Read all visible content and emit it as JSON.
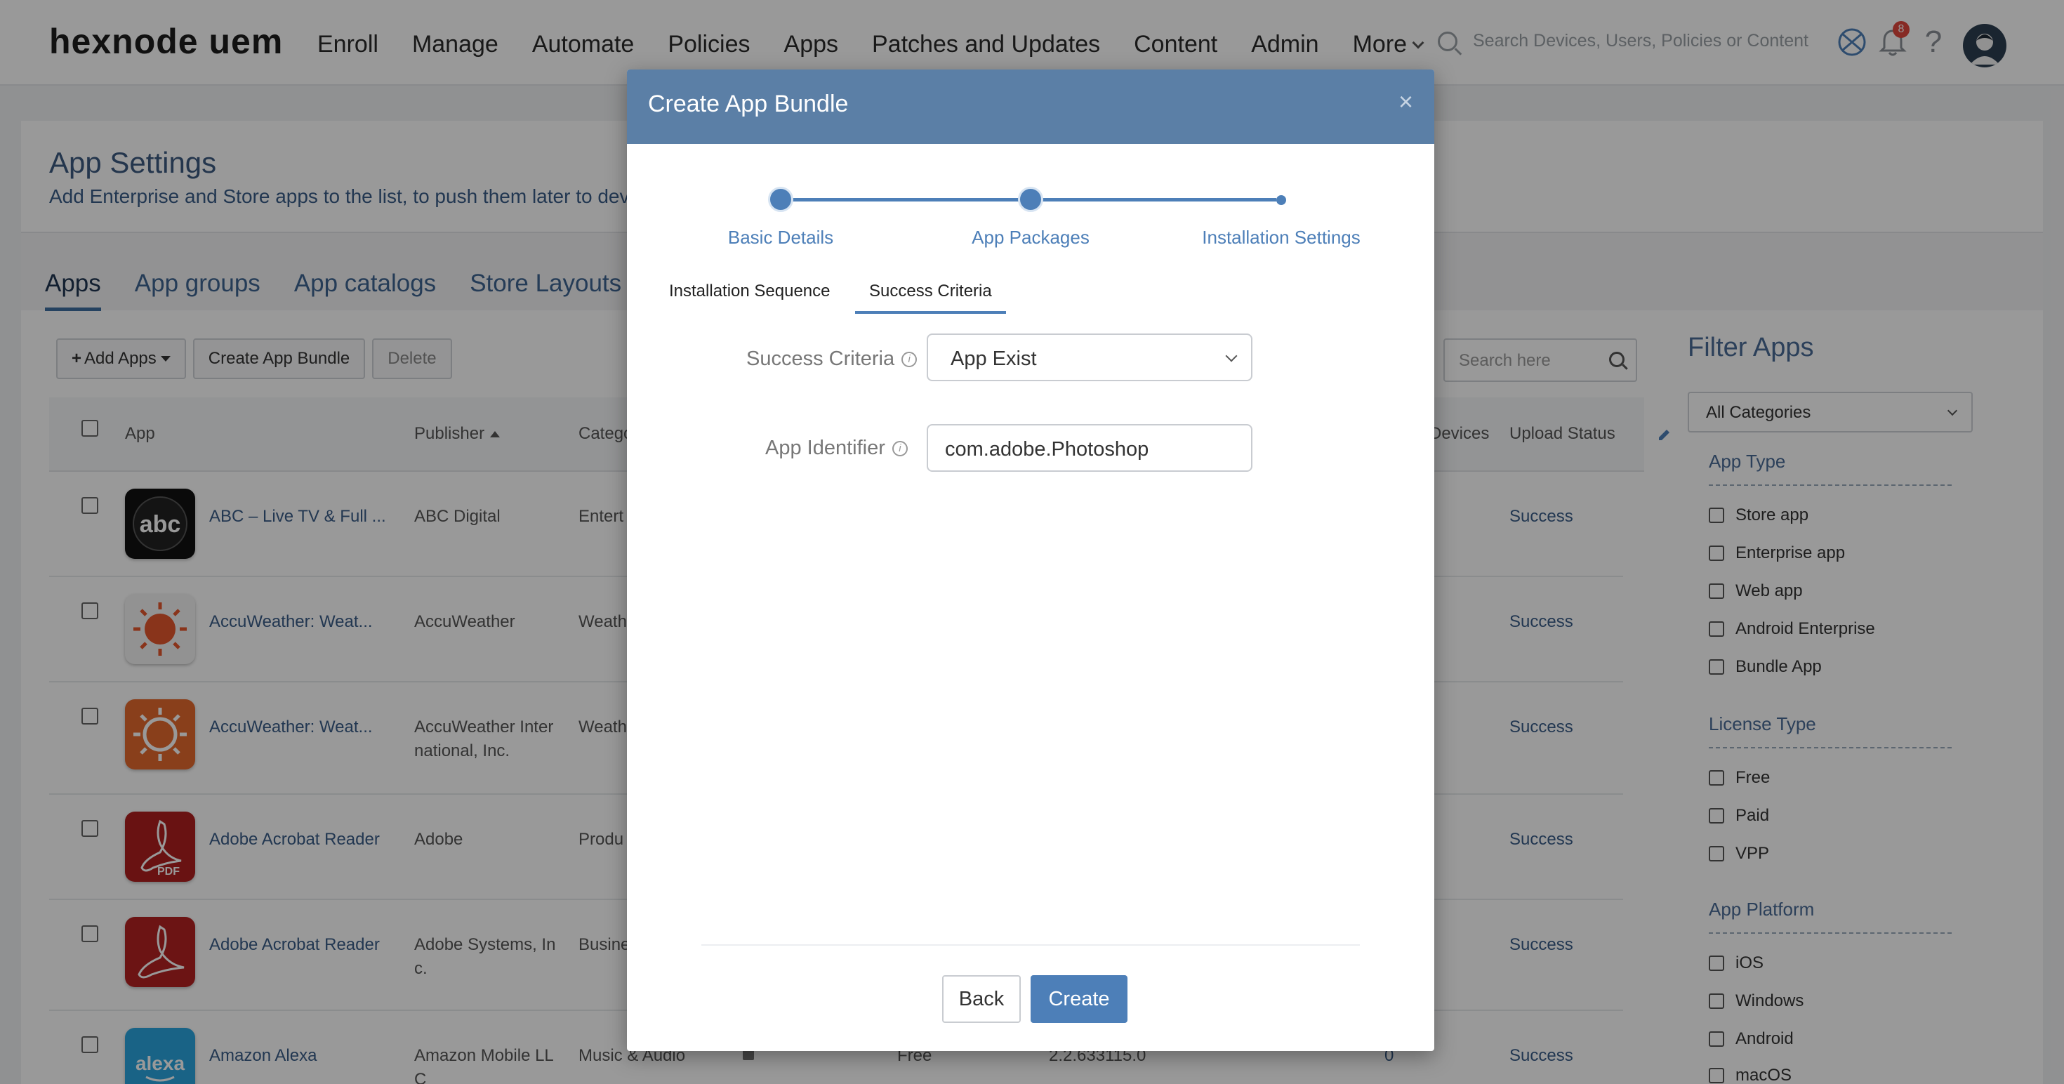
{
  "topnav": {
    "brand": "hexnode uem",
    "links": [
      "Enroll",
      "Manage",
      "Automate",
      "Policies",
      "Apps",
      "Patches and Updates",
      "Content",
      "Admin"
    ],
    "more_label": "More",
    "search_placeholder": "Search Devices, Users, Policies or Content",
    "notification_count": "8",
    "help_glyph": "?"
  },
  "page": {
    "title": "App Settings",
    "subtitle": "Add Enterprise and Store apps to the list, to push them later to devic",
    "tabs": [
      "Apps",
      "App groups",
      "App catalogs",
      "Store Layouts"
    ],
    "active_tab": "Apps"
  },
  "toolbar": {
    "add_apps": "Add Apps",
    "create_bundle": "Create App Bundle",
    "delete": "Delete",
    "search_placeholder": "Search here"
  },
  "table": {
    "headers": {
      "app": "App",
      "publisher": "Publisher",
      "category": "Catego",
      "devices": "Devices",
      "upload_status": "Upload Status"
    },
    "rows": [
      {
        "name": "ABC – Live TV & Full ...",
        "publisher": "ABC Digital",
        "publisher2": "",
        "category": "Entert",
        "status": "Success",
        "icon": "abc-icon"
      },
      {
        "name": "AccuWeather: Weat...",
        "publisher": "AccuWeather",
        "publisher2": "",
        "category": "Weath",
        "status": "Success",
        "icon": "sun-icon"
      },
      {
        "name": "AccuWeather: Weat...",
        "publisher": "AccuWeather Inter",
        "publisher2": "national, Inc.",
        "category": "Weath",
        "status": "Success",
        "icon": "sun-icon"
      },
      {
        "name": "Adobe Acrobat Reader",
        "publisher": "Adobe",
        "publisher2": "",
        "category": "Produ",
        "status": "Success",
        "icon": "pdf-icon"
      },
      {
        "name": "Adobe Acrobat Reader",
        "publisher": "Adobe Systems, In",
        "publisher2": "c.",
        "category": "Busine",
        "status": "Success",
        "icon": "acrobat-icon"
      },
      {
        "name": "Amazon Alexa",
        "publisher": "Amazon Mobile LL",
        "publisher2": "C",
        "category": "Music & Audio",
        "license": "Free",
        "version": "2.2.633115.0",
        "devices": "0",
        "status": "Success",
        "icon": "alexa-icon"
      }
    ]
  },
  "filter": {
    "title": "Filter Apps",
    "category_select": "All Categories",
    "groups": [
      {
        "title": "App Type",
        "options": [
          "Store app",
          "Enterprise app",
          "Web app",
          "Android Enterprise",
          "Bundle App"
        ]
      },
      {
        "title": "License Type",
        "options": [
          "Free",
          "Paid",
          "VPP"
        ]
      },
      {
        "title": "App Platform",
        "options": [
          "iOS",
          "Windows",
          "Android",
          "macOS"
        ]
      }
    ]
  },
  "modal": {
    "title": "Create App Bundle",
    "close_glyph": "×",
    "steps": [
      "Basic Details",
      "App Packages",
      "Installation Settings"
    ],
    "subtabs": [
      "Installation Sequence",
      "Success Criteria"
    ],
    "active_subtab": "Success Criteria",
    "success_criteria_label": "Success Criteria",
    "success_criteria_value": "App Exist",
    "app_identifier_label": "App Identifier",
    "app_identifier_value": "com.adobe.Photoshop",
    "info_glyph": "i",
    "back_label": "Back",
    "create_label": "Create"
  },
  "colors": {
    "modal_header": "#5b7fa6",
    "accent": "#4d7fb8",
    "badge": "#e0463c"
  }
}
